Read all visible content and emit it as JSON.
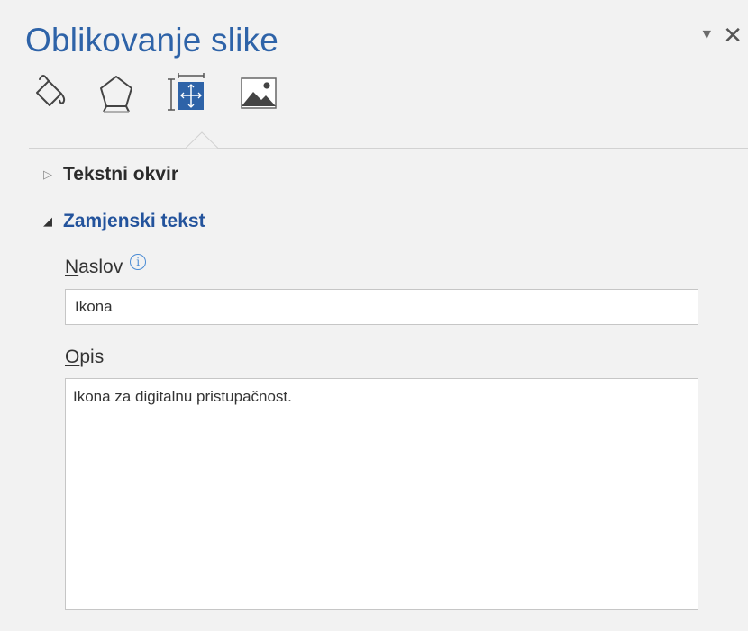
{
  "pane": {
    "title": "Oblikovanje slike",
    "dropdown_glyph": "▼",
    "close_glyph": "✕"
  },
  "tabs": [
    {
      "icon": "paint-bucket-icon",
      "label": "Fill & Line"
    },
    {
      "icon": "pentagon-effects-icon",
      "label": "Effects"
    },
    {
      "icon": "size-properties-icon",
      "label": "Size & Properties",
      "selected": true
    },
    {
      "icon": "picture-icon",
      "label": "Picture"
    }
  ],
  "sections": {
    "text_box": {
      "label": "Tekstni okvir",
      "expanded": false,
      "arrow": "▷"
    },
    "alt_text": {
      "label": "Zamjenski tekst",
      "expanded": true,
      "arrow": "◢"
    }
  },
  "fields": {
    "title": {
      "label_accel": "N",
      "label_rest": "aslov",
      "value": "Ikona"
    },
    "description": {
      "label_accel": "O",
      "label_rest": "pis",
      "value": "Ikona za digitalnu pristupačnost."
    }
  },
  "colors": {
    "title_blue": "#2e63a8",
    "section_blue": "#23539c",
    "pane_bg": "#f2f2f2",
    "selected_icon_blue": "#2e63a8"
  }
}
